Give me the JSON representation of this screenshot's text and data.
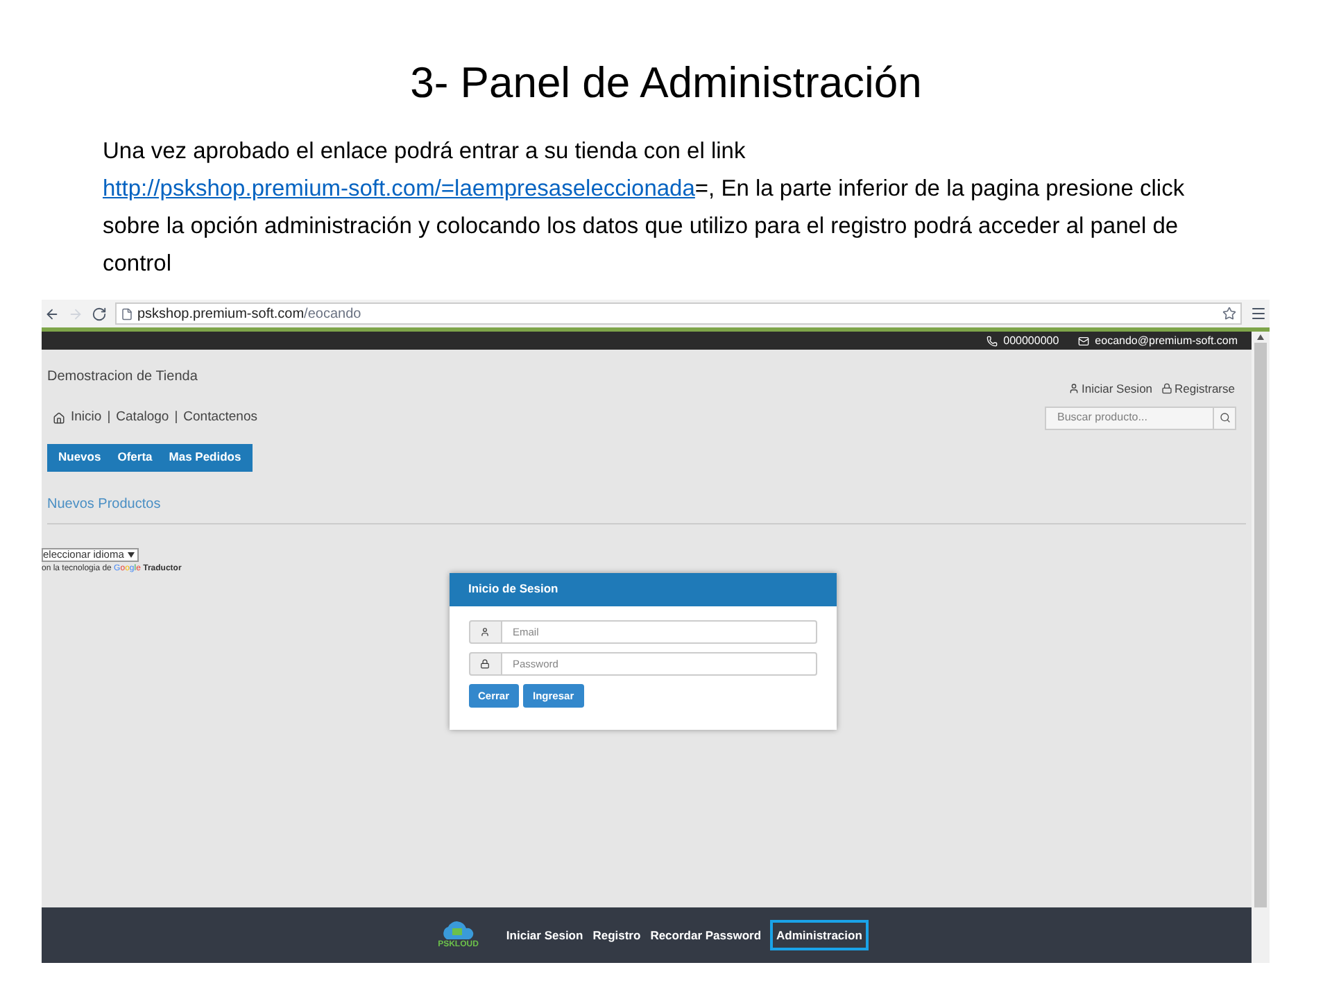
{
  "slide": {
    "title": "3- Panel de Administración",
    "paragraph": {
      "before": "Una vez aprobado el enlace podrá entrar a su tienda con el link ",
      "link": "http://pskshop.premium-soft.com/=laempresaseleccionada",
      "after": "=,   En la parte inferior de la pagina presione click sobre la opción administración y colocando los datos que utilizo para el registro podrá acceder al panel de control"
    }
  },
  "browser": {
    "url": {
      "host": "pskshop.premium-soft.com",
      "path": "/eocando"
    },
    "topbar": {
      "phone": "000000000",
      "email": "eocando@premium-soft.com"
    },
    "store_name": "Demostracion de Tienda",
    "account_links": [
      {
        "kind": "user",
        "label": "Iniciar Sesion"
      },
      {
        "kind": "lock",
        "label": "Registrarse"
      }
    ],
    "nav_links": [
      "Inicio",
      "Catalogo",
      "Contactenos"
    ],
    "nav_separator": "|",
    "search": {
      "placeholder": "Buscar producto..."
    },
    "tabs": [
      "Nuevos",
      "Oferta",
      "Mas Pedidos"
    ],
    "section_title": "Nuevos Productos",
    "language": {
      "select": "eleccionar idioma",
      "credit": "on la tecnologia de",
      "google": "Google",
      "translator": "Traductor"
    },
    "login": {
      "title": "Inicio de Sesion",
      "fields": [
        {
          "kind": "user",
          "placeholder": "Email"
        },
        {
          "kind": "lock",
          "placeholder": "Password"
        }
      ],
      "buttons": [
        "Cerrar",
        "Ingresar"
      ]
    },
    "footer": {
      "logo": "PSKLOUD",
      "links": [
        {
          "label": "Iniciar Sesion",
          "highlighted": false
        },
        {
          "label": "Registro",
          "highlighted": false
        },
        {
          "label": "Recordar Password",
          "highlighted": false
        },
        {
          "label": "Administracion",
          "highlighted": true
        }
      ]
    }
  }
}
